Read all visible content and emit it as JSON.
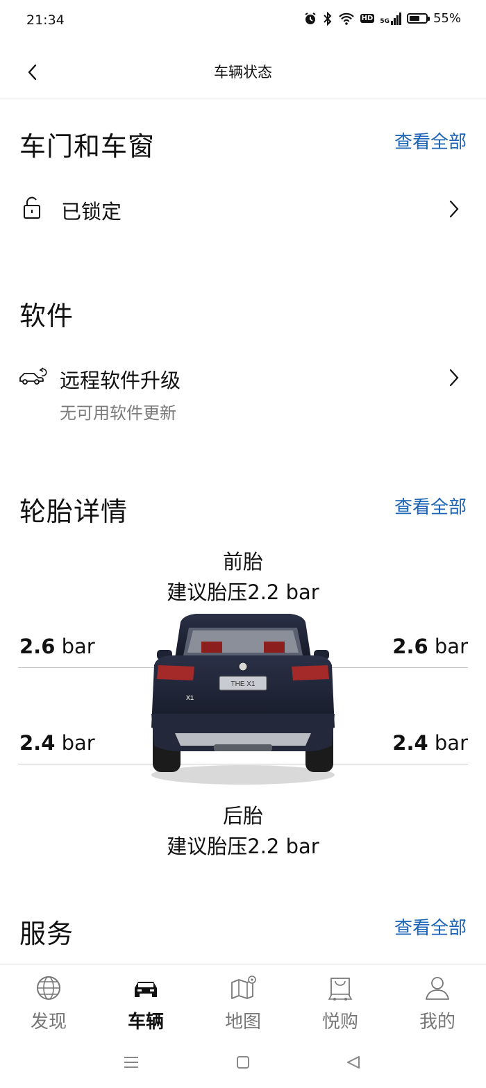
{
  "status_bar": {
    "time": "21:34",
    "network": "5G",
    "hd_label": "HD",
    "battery_percent": "55%",
    "battery_level": 0.55
  },
  "header": {
    "title": "车辆状态"
  },
  "doors_windows": {
    "title": "车门和车窗",
    "view_all": "查看全部",
    "lock_status": "已锁定"
  },
  "software": {
    "title": "软件",
    "item_label": "远程软件升级",
    "item_sub": "无可用软件更新"
  },
  "tires": {
    "title": "轮胎详情",
    "view_all": "查看全部",
    "front_label": "前胎",
    "front_recommended": "建议胎压2.2 bar",
    "rear_label": "后胎",
    "rear_recommended": "建议胎压2.2 bar",
    "unit": "bar",
    "front_left": "2.6",
    "front_right": "2.6",
    "rear_left": "2.4",
    "rear_right": "2.4",
    "car_plate_text": "THE X1",
    "car_badge_text": "X1"
  },
  "services": {
    "title": "服务",
    "view_all": "查看全部"
  },
  "bottom_nav": {
    "items": [
      {
        "label": "发现",
        "icon": "globe-icon"
      },
      {
        "label": "车辆",
        "icon": "car-icon",
        "active": true
      },
      {
        "label": "地图",
        "icon": "map-icon"
      },
      {
        "label": "悦购",
        "icon": "shopping-bag-icon"
      },
      {
        "label": "我的",
        "icon": "person-icon"
      }
    ]
  },
  "colors": {
    "accent": "#1d64b4",
    "text": "#111111",
    "muted": "#7a7a7a"
  }
}
